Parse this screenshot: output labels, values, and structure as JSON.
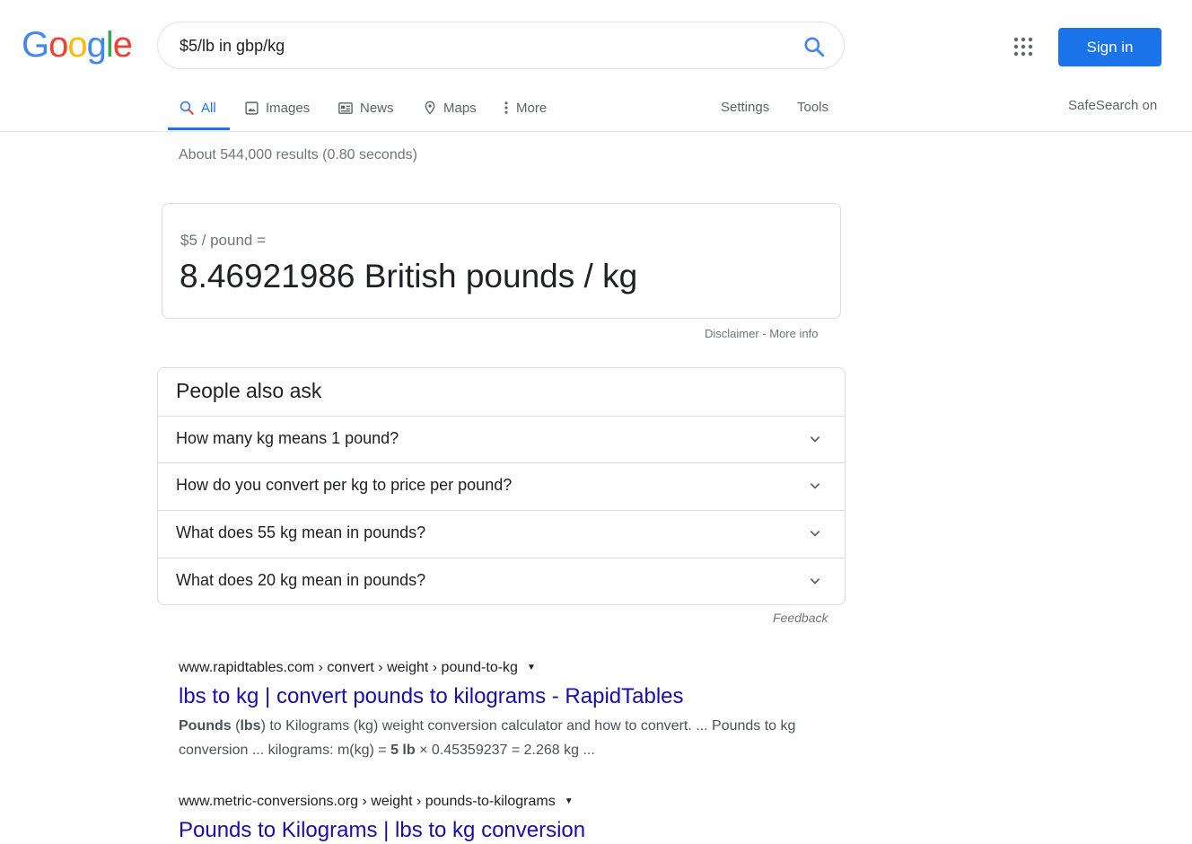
{
  "logo": {
    "letters": [
      {
        "char": "G",
        "color": "#4285f4"
      },
      {
        "char": "o",
        "color": "#ea4335"
      },
      {
        "char": "o",
        "color": "#fbbc05"
      },
      {
        "char": "g",
        "color": "#4285f4"
      },
      {
        "char": "l",
        "color": "#34a853"
      },
      {
        "char": "e",
        "color": "#ea4335"
      }
    ]
  },
  "search": {
    "query": "$5/lb in gbp/kg"
  },
  "header": {
    "signin_label": "Sign in",
    "apps_icon": "apps-grid-icon"
  },
  "tabs": [
    {
      "label": "All",
      "icon": "search-icon",
      "active": true
    },
    {
      "label": "Images",
      "icon": "image-icon"
    },
    {
      "label": "News",
      "icon": "news-icon"
    },
    {
      "label": "Maps",
      "icon": "map-pin-icon"
    },
    {
      "label": "More",
      "icon": "more-vert-icon"
    }
  ],
  "tools": {
    "settings": "Settings",
    "tools": "Tools",
    "safesearch": "SafeSearch on"
  },
  "stats": "About 544,000 results (0.80 seconds)",
  "converter": {
    "from": "$5 / pound =",
    "result": "8.46921986 British pounds / kg",
    "disclaimer": "Disclaimer",
    "separator": " - ",
    "more_info": "More info"
  },
  "paa": {
    "title": "People also ask",
    "questions": [
      "How many kg means 1 pound?",
      "How do you convert per kg to price per pound?",
      "What does 55 kg mean in pounds?",
      "What does 20 kg mean in pounds?"
    ],
    "feedback": "Feedback"
  },
  "results": [
    {
      "cite": "www.rapidtables.com › convert › weight › pound-to-kg",
      "title": "lbs to kg | convert pounds to kilograms - RapidTables",
      "snippet": [
        {
          "t": "Pounds",
          "b": true
        },
        {
          "t": " (",
          "b": false
        },
        {
          "t": "lbs",
          "b": true
        },
        {
          "t": ") to Kilograms (kg) weight conversion calculator and how to convert. ... Pounds to kg conversion ... kilograms: m(kg) = ",
          "b": false
        },
        {
          "t": "5 lb",
          "b": true
        },
        {
          "t": " × 0.45359237 = 2.268 kg ...",
          "b": false
        }
      ]
    },
    {
      "cite": "www.metric-conversions.org › weight › pounds-to-kilograms",
      "title": "Pounds to Kilograms | lbs to kg conversion",
      "snippet": []
    }
  ],
  "colors": {
    "accent": "#1a73e8",
    "link": "#1a0dab",
    "muted": "#70757a"
  }
}
